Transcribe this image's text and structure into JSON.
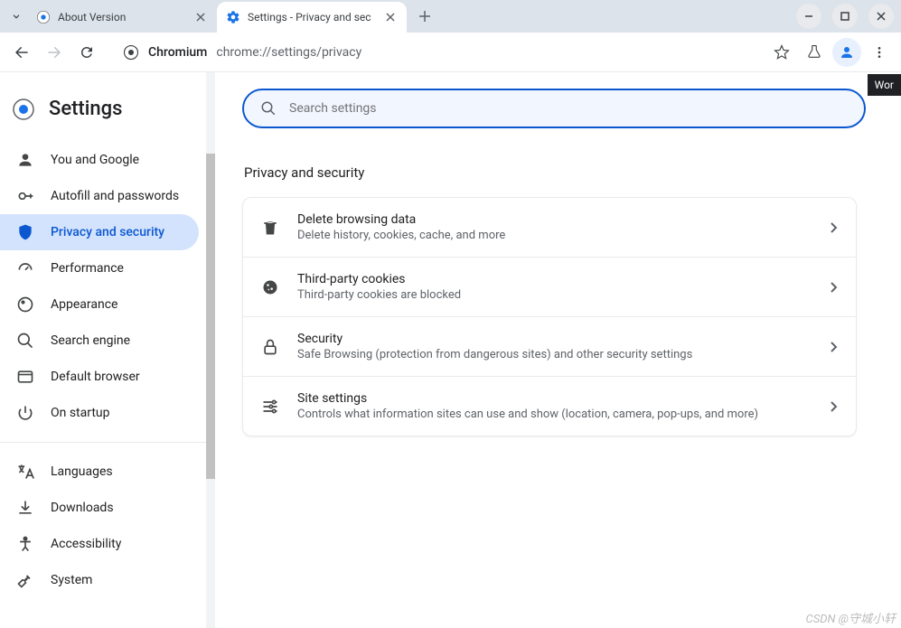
{
  "tabs": [
    {
      "title": "About Version",
      "favicon": "chromium"
    },
    {
      "title": "Settings - Privacy and sec",
      "favicon": "gear"
    }
  ],
  "omnibox": {
    "chip": "Chromium",
    "url": "chrome://settings/privacy"
  },
  "tooltip": "Wor",
  "settings_title": "Settings",
  "search_placeholder": "Search settings",
  "sidebar": {
    "groupA": [
      {
        "label": "You and Google"
      },
      {
        "label": "Autofill and passwords"
      },
      {
        "label": "Privacy and security"
      },
      {
        "label": "Performance"
      },
      {
        "label": "Appearance"
      },
      {
        "label": "Search engine"
      },
      {
        "label": "Default browser"
      },
      {
        "label": "On startup"
      }
    ],
    "groupB": [
      {
        "label": "Languages"
      },
      {
        "label": "Downloads"
      },
      {
        "label": "Accessibility"
      },
      {
        "label": "System"
      }
    ]
  },
  "section_title": "Privacy and security",
  "rows": [
    {
      "title": "Delete browsing data",
      "sub": "Delete history, cookies, cache, and more"
    },
    {
      "title": "Third-party cookies",
      "sub": "Third-party cookies are blocked"
    },
    {
      "title": "Security",
      "sub": "Safe Browsing (protection from dangerous sites) and other security settings"
    },
    {
      "title": "Site settings",
      "sub": "Controls what information sites can use and show (location, camera, pop-ups, and more)"
    }
  ],
  "watermark": "CSDN @守城小轩"
}
